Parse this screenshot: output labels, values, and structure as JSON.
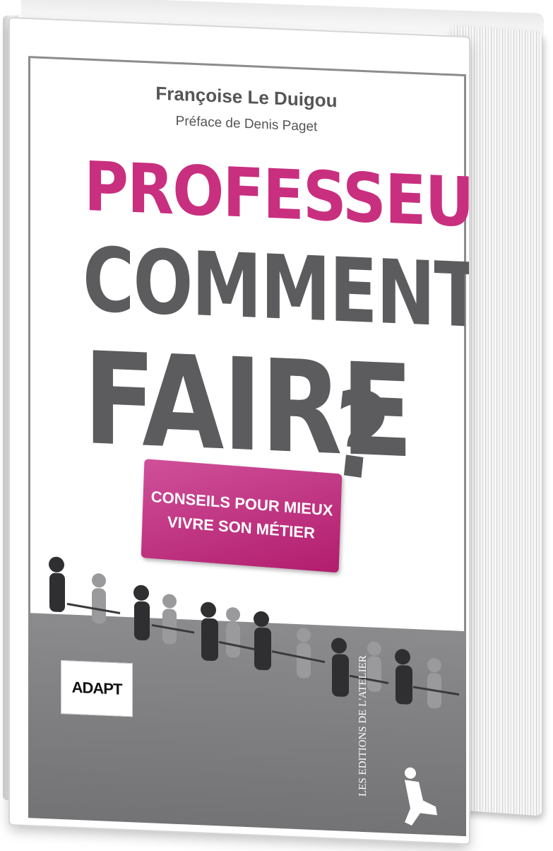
{
  "book": {
    "author": "Françoise Le Duigou",
    "preface": "Préface de Denis Paget",
    "title_line1": "PROFESSEUR",
    "title_line2": "COMMENT",
    "title_line3": "FAIRE",
    "title_mark": "?",
    "subtitle_line1": "CONSEILS POUR MIEUX",
    "subtitle_line2": "VIVRE SON MÉTIER",
    "logo_text": "ADAPT",
    "publisher": "LES EDITIONS DE L'ATELIER"
  },
  "colors": {
    "accent": "#c92f7f",
    "title_grey": "#5c5c5e",
    "band_grey": "#7f7f81"
  },
  "icons": {
    "classroom": "classroom-silhouettes",
    "publisher_figure": "seated-figure-logo"
  }
}
